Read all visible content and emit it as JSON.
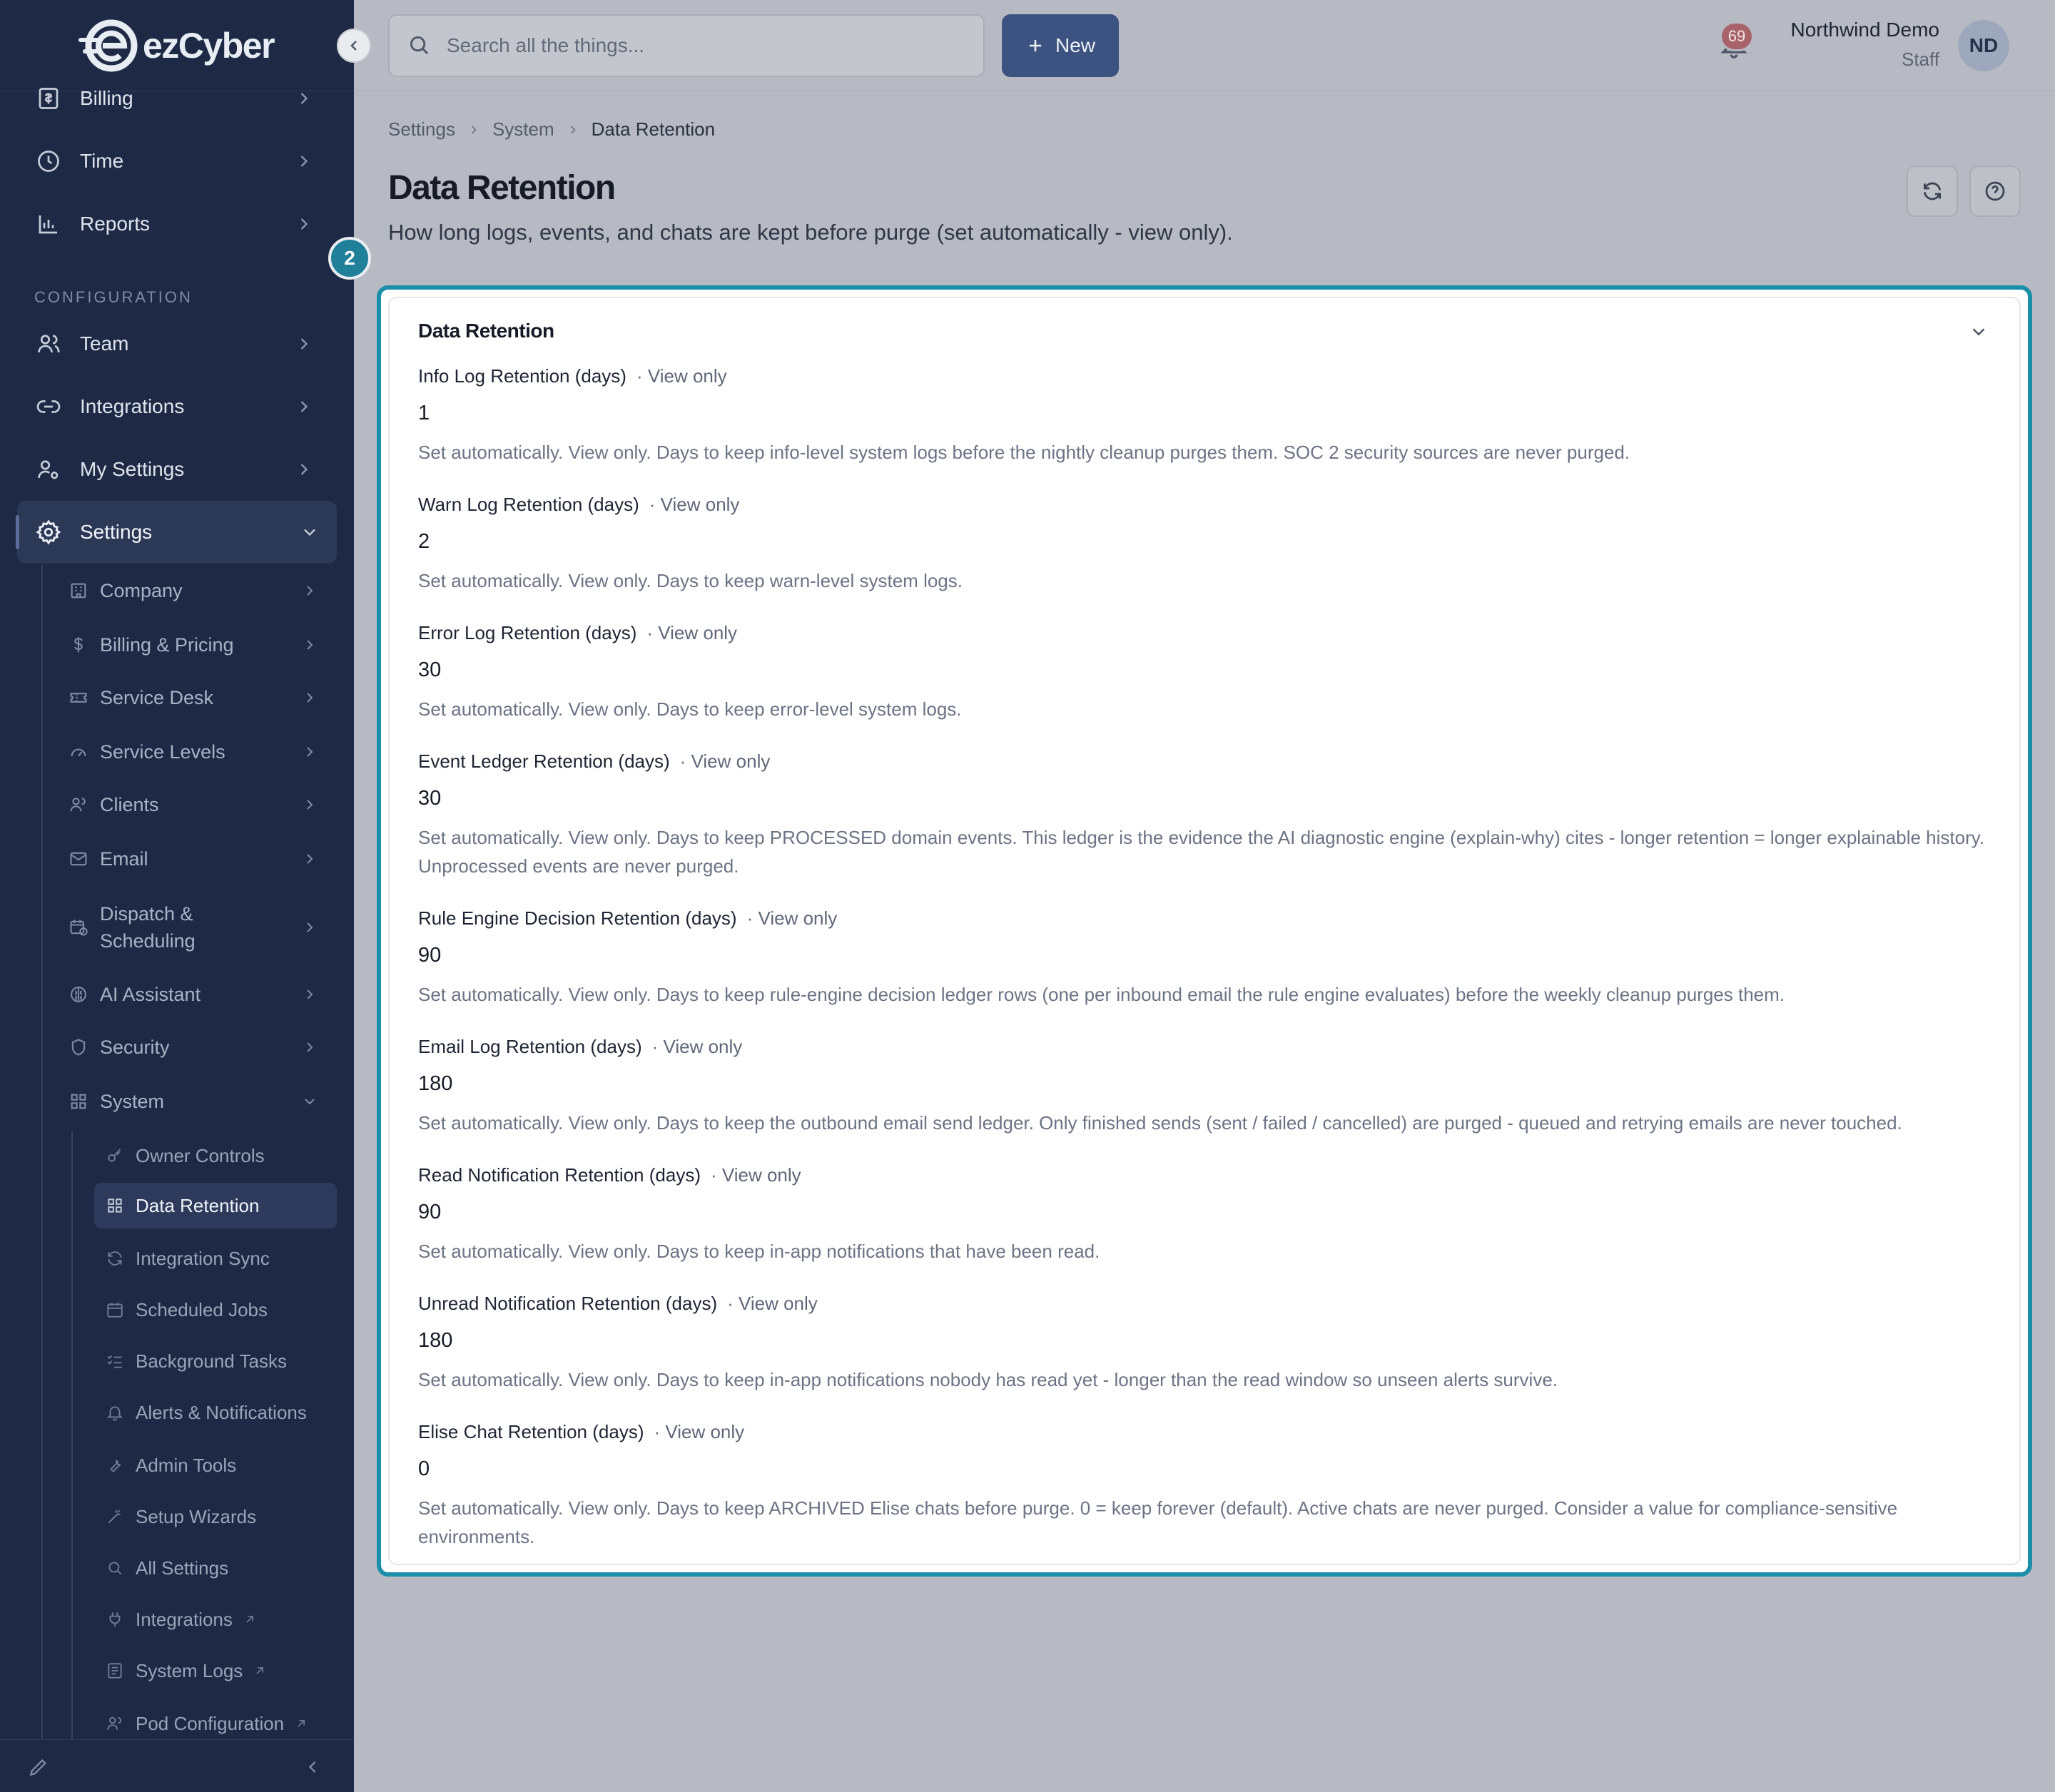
{
  "app": {
    "logo_text": "ezCyber"
  },
  "sidebar": {
    "top_items": [
      {
        "label": "Billing"
      },
      {
        "label": "Time"
      },
      {
        "label": "Reports"
      }
    ],
    "section_label": "CONFIGURATION",
    "config_items": [
      {
        "label": "Team"
      },
      {
        "label": "Integrations"
      },
      {
        "label": "My Settings"
      },
      {
        "label": "Settings"
      }
    ],
    "settings_children": [
      {
        "label": "Company"
      },
      {
        "label": "Billing & Pricing"
      },
      {
        "label": "Service Desk"
      },
      {
        "label": "Service Levels"
      },
      {
        "label": "Clients"
      },
      {
        "label": "Email"
      },
      {
        "label": "Dispatch &"
      },
      {
        "label": "Scheduling"
      },
      {
        "label": "AI Assistant"
      },
      {
        "label": "Security"
      },
      {
        "label": "System"
      }
    ],
    "system_children": [
      {
        "label": "Owner Controls"
      },
      {
        "label": "Data Retention"
      },
      {
        "label": "Integration Sync"
      },
      {
        "label": "Scheduled Jobs"
      },
      {
        "label": "Background Tasks"
      },
      {
        "label": "Alerts & Notifications"
      },
      {
        "label": "Admin Tools"
      },
      {
        "label": "Setup Wizards"
      },
      {
        "label": "All Settings"
      },
      {
        "label": "Integrations"
      },
      {
        "label": "System Logs"
      },
      {
        "label": "Pod Configuration"
      }
    ]
  },
  "topbar": {
    "search_placeholder": "Search all the things...",
    "new_label": "New",
    "notification_count": "69",
    "user_name": "Northwind Demo",
    "user_role": "Staff",
    "avatar_initials": "ND"
  },
  "breadcrumb": [
    "Settings",
    "System",
    "Data Retention"
  ],
  "page": {
    "title": "Data Retention",
    "subtitle": "How long logs, events, and chats are kept before purge (set automatically - view only).",
    "step_badge": "2"
  },
  "card": {
    "title": "Data Retention",
    "view_only_label": "· View only",
    "fields": [
      {
        "label": "Info Log Retention (days)",
        "value": "1",
        "help": "Set automatically. View only. Days to keep info-level system logs before the nightly cleanup purges them. SOC 2 security sources are never purged."
      },
      {
        "label": "Warn Log Retention (days)",
        "value": "2",
        "help": "Set automatically. View only. Days to keep warn-level system logs."
      },
      {
        "label": "Error Log Retention (days)",
        "value": "30",
        "help": "Set automatically. View only. Days to keep error-level system logs."
      },
      {
        "label": "Event Ledger Retention (days)",
        "value": "30",
        "help": "Set automatically. View only. Days to keep PROCESSED domain events. This ledger is the evidence the AI diagnostic engine (explain-why) cites - longer retention = longer explainable history. Unprocessed events are never purged."
      },
      {
        "label": "Rule Engine Decision Retention (days)",
        "value": "90",
        "help": "Set automatically. View only. Days to keep rule-engine decision ledger rows (one per inbound email the rule engine evaluates) before the weekly cleanup purges them."
      },
      {
        "label": "Email Log Retention (days)",
        "value": "180",
        "help": "Set automatically. View only. Days to keep the outbound email send ledger. Only finished sends (sent / failed / cancelled) are purged - queued and retrying emails are never touched."
      },
      {
        "label": "Read Notification Retention (days)",
        "value": "90",
        "help": "Set automatically. View only. Days to keep in-app notifications that have been read."
      },
      {
        "label": "Unread Notification Retention (days)",
        "value": "180",
        "help": "Set automatically. View only. Days to keep in-app notifications nobody has read yet - longer than the read window so unseen alerts survive."
      },
      {
        "label": "Elise Chat Retention (days)",
        "value": "0",
        "help": "Set automatically. View only. Days to keep ARCHIVED Elise chats before purge. 0 = keep forever (default). Active chats are never purged. Consider a value for compliance-sensitive environments."
      }
    ]
  }
}
